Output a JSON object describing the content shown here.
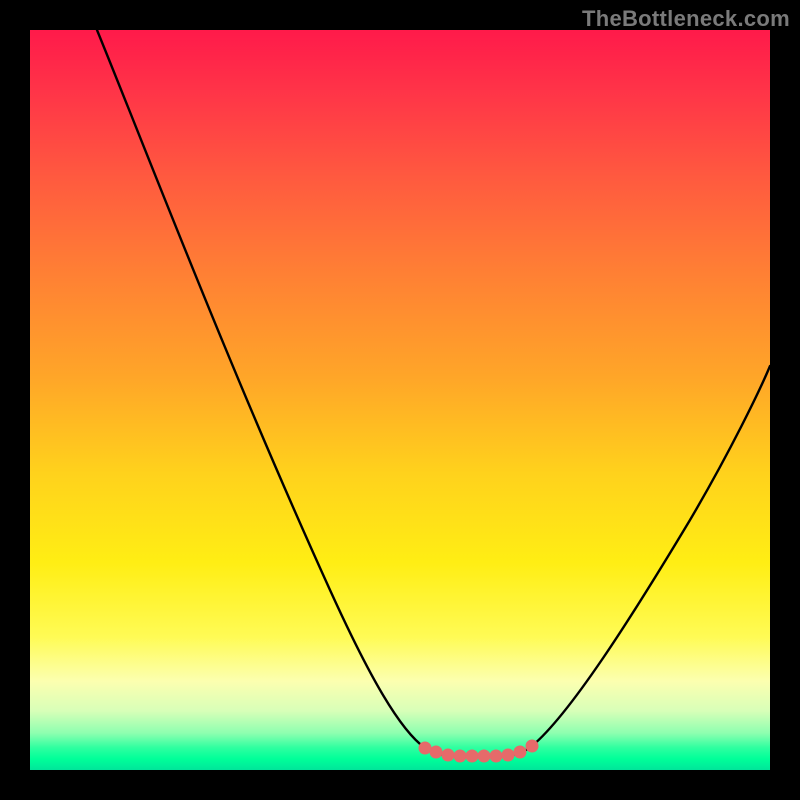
{
  "watermark": "TheBottleneck.com",
  "colors": {
    "frame": "#000000",
    "gradient_top": "#ff1a4a",
    "gradient_mid": "#ffee14",
    "gradient_bottom": "#00e59a",
    "curve": "#000000",
    "marker": "#e66a6a"
  },
  "chart_data": {
    "type": "line",
    "title": "",
    "xlabel": "",
    "ylabel": "",
    "xlim": [
      0,
      100
    ],
    "ylim": [
      0,
      100
    ],
    "note": "No axes/ticks shown. Values are estimates read from pixel positions on a 0–100 normalized scale (0 = left/bottom of gradient area, 100 = right/top).",
    "series": [
      {
        "name": "left-branch",
        "x": [
          9,
          15,
          20,
          25,
          30,
          35,
          40,
          45,
          50,
          53
        ],
        "y": [
          100,
          86,
          75,
          64,
          52,
          41,
          30,
          18,
          8,
          3
        ]
      },
      {
        "name": "valley-floor",
        "x": [
          53,
          55,
          57,
          59,
          61,
          63,
          65,
          67
        ],
        "y": [
          3,
          2,
          2,
          2,
          2,
          2,
          2,
          3
        ]
      },
      {
        "name": "right-branch",
        "x": [
          67,
          72,
          77,
          82,
          87,
          92,
          97,
          100
        ],
        "y": [
          3,
          10,
          19,
          28,
          38,
          48,
          58,
          64
        ]
      }
    ],
    "markers": {
      "name": "valley-markers",
      "color": "#e66a6a",
      "x": [
        53,
        55,
        57,
        59,
        61,
        63,
        65,
        67
      ],
      "y": [
        3,
        2,
        2,
        2,
        2,
        2,
        2,
        3
      ]
    }
  }
}
